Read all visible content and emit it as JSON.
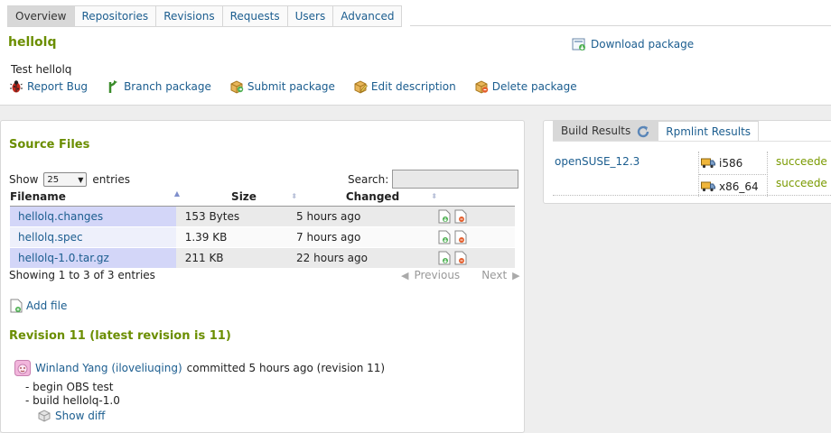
{
  "tabs": [
    "Overview",
    "Repositories",
    "Revisions",
    "Requests",
    "Users",
    "Advanced"
  ],
  "package": {
    "name": "hellolq",
    "description": "Test hellolq",
    "download_label": "Download package",
    "actions": [
      "Report Bug",
      "Branch package",
      "Submit package",
      "Edit description",
      "Delete package"
    ]
  },
  "source": {
    "title": "Source Files",
    "show_label": "Show",
    "page_length": "25",
    "entries_label": "entries",
    "search_label": "Search:",
    "search_value": "",
    "columns": [
      "Filename",
      "Size",
      "Changed"
    ],
    "rows": [
      {
        "filename": "hellolq.changes",
        "size": "153 Bytes",
        "changed": "5 hours ago"
      },
      {
        "filename": "hellolq.spec",
        "size": "1.39 KB",
        "changed": "7 hours ago"
      },
      {
        "filename": "hellolq-1.0.tar.gz",
        "size": "211 KB",
        "changed": "22 hours ago"
      }
    ],
    "showing": "Showing 1 to 3 of 3 entries",
    "previous_label": "Previous",
    "next_label": "Next",
    "add_file_label": "Add file"
  },
  "revision": {
    "title": "Revision 11 (latest revision is 11)",
    "author": "Winland Yang (iloveliuqing)",
    "commit_text": "committed 5 hours ago (revision 11)",
    "messages": [
      "- begin OBS test",
      "- build hellolq-1.0"
    ],
    "show_diff_label": "Show diff"
  },
  "build": {
    "tabs": [
      "Build Results",
      "Rpmlint Results"
    ],
    "repository": "openSUSE_12.3",
    "archs": [
      {
        "arch": "i586",
        "status": "succeede"
      },
      {
        "arch": "x86_64",
        "status": "succeede"
      }
    ]
  },
  "colors": {
    "link": "#1b5d8f",
    "heading_green": "#6b8e00",
    "status_green": "#7a9a01",
    "row_highlight": "#d3d6f8"
  },
  "icons": [
    "bug-icon",
    "branch-icon",
    "submit-icon",
    "edit-icon",
    "delete-icon",
    "download-icon",
    "refresh-icon",
    "add-file-icon",
    "avatar-icon",
    "show-diff-icon",
    "truck-icon",
    "file-download-icon",
    "file-delete-icon"
  ]
}
